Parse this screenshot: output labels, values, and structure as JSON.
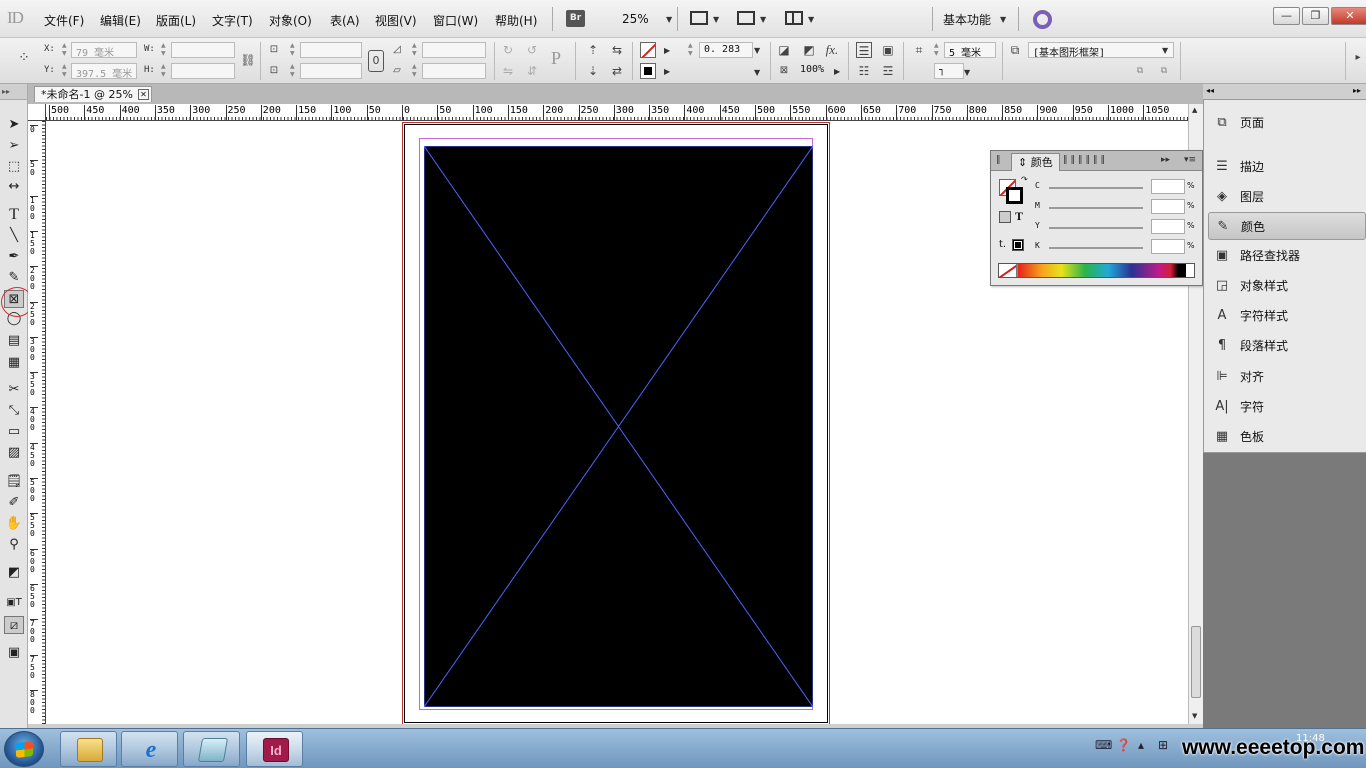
{
  "app": {
    "logo": "ID",
    "menus": [
      "文件(F)",
      "编辑(E)",
      "版面(L)",
      "文字(T)",
      "对象(O)",
      "表(A)",
      "视图(V)",
      "窗口(W)",
      "帮助(H)"
    ],
    "bridge_button": "Br",
    "zoom": "25%",
    "workspace": "基本功能",
    "window_controls": {
      "minimize": "—",
      "restore": "❐",
      "close": "✕"
    }
  },
  "control_bar": {
    "x_label": "X:",
    "x_value": "79 毫米",
    "y_label": "Y:",
    "y_value": "397.5 毫米",
    "w_label": "W:",
    "w_value": "",
    "h_label": "H:",
    "h_value": "",
    "stroke_weight": "0. 283",
    "opacity": "100%",
    "columns": "5 毫米",
    "object_style": "[基本图形框架]",
    "fx_label": "fx."
  },
  "document": {
    "tab_title": "*未命名-1 @ 25%",
    "tab_close": "✕",
    "ruler_top": [
      "500",
      "450",
      "400",
      "350",
      "300",
      "250",
      "200",
      "150",
      "100",
      "50",
      "0",
      "50",
      "100",
      "150",
      "200",
      "250",
      "300",
      "350",
      "400",
      "450",
      "500",
      "550",
      "600",
      "650",
      "700",
      "750",
      "800",
      "850",
      "900",
      "950",
      "1000",
      "1050"
    ],
    "ruler_left": [
      "0",
      "5\n0",
      "1\n0\n0",
      "1\n5\n0",
      "2\n0\n0",
      "2\n5\n0",
      "3\n0\n0",
      "3\n5\n0",
      "4\n0\n0",
      "4\n5\n0",
      "5\n0\n0",
      "5\n5\n0",
      "6\n0\n0",
      "6\n5\n0",
      "7\n0\n0",
      "7\n5\n0",
      "8\n0\n0"
    ]
  },
  "color_panel": {
    "tab_label": "颜色",
    "channels": [
      {
        "label": "C",
        "value": ""
      },
      {
        "label": "M",
        "value": ""
      },
      {
        "label": "Y",
        "value": ""
      },
      {
        "label": "K",
        "value": ""
      }
    ],
    "percent": "%",
    "text_icon": "T"
  },
  "dock": {
    "items": [
      {
        "name": "pages",
        "label": "页面",
        "icon": "pages-icon",
        "glyph": "⧉"
      },
      {
        "name": "stroke",
        "label": "描边",
        "icon": "stroke-icon",
        "glyph": "☰"
      },
      {
        "name": "layers",
        "label": "图层",
        "icon": "layers-icon",
        "glyph": "◈"
      },
      {
        "name": "color",
        "label": "颜色",
        "icon": "color-icon",
        "glyph": "✎"
      },
      {
        "name": "pathfinder",
        "label": "路径查找器",
        "icon": "pathfinder-icon",
        "glyph": "▣"
      },
      {
        "name": "object-styles",
        "label": "对象样式",
        "icon": "object-styles-icon",
        "glyph": "◲"
      },
      {
        "name": "character-styles",
        "label": "字符样式",
        "icon": "character-styles-icon",
        "glyph": "A"
      },
      {
        "name": "paragraph-styles",
        "label": "段落样式",
        "icon": "paragraph-styles-icon",
        "glyph": "¶"
      },
      {
        "name": "align",
        "label": "对齐",
        "icon": "align-icon",
        "glyph": "⊫"
      },
      {
        "name": "character",
        "label": "字符",
        "icon": "character-icon",
        "glyph": "A|"
      },
      {
        "name": "swatches",
        "label": "色板",
        "icon": "swatches-icon",
        "glyph": "▦"
      }
    ],
    "active": "color"
  },
  "taskbar": {
    "indesign_label": "Id",
    "clock": "11:48",
    "watermark": "www.eeeetop.com"
  },
  "colors": {
    "frame_fill": "#000000",
    "frame_diagonals": "#4a64ff",
    "page_border": "#b02a2a",
    "margin_guide": "#c56ad2",
    "workspace_ring": "#7a5fb6",
    "indesign_icon": "#a21a4a"
  }
}
